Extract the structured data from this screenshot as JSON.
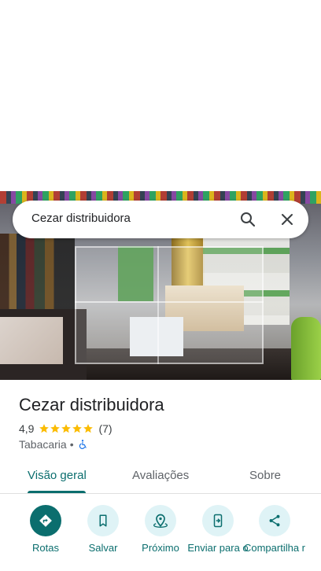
{
  "search": {
    "value": "Cezar distribuidora"
  },
  "place": {
    "name": "Cezar distribuidora",
    "rating": "4,9",
    "stars": 5,
    "review_count": "(7)",
    "category": "Tabacaria",
    "separator": "•"
  },
  "tabs": [
    {
      "label": "Visão geral",
      "active": true
    },
    {
      "label": "Avaliações",
      "active": false
    },
    {
      "label": "Sobre",
      "active": false
    }
  ],
  "actions": [
    {
      "label": "Rotas",
      "icon": "directions-icon"
    },
    {
      "label": "Salvar",
      "icon": "bookmark-icon"
    },
    {
      "label": "Próximo",
      "icon": "nearby-icon"
    },
    {
      "label": "Enviar para o",
      "icon": "send-to-phone-icon"
    },
    {
      "label": "Compartilha r",
      "icon": "share-icon"
    }
  ],
  "colors": {
    "accent": "#0b6e6e",
    "accent_light": "#dff3f6",
    "star": "#fbbc04",
    "wheelchair": "#1a73e8"
  }
}
